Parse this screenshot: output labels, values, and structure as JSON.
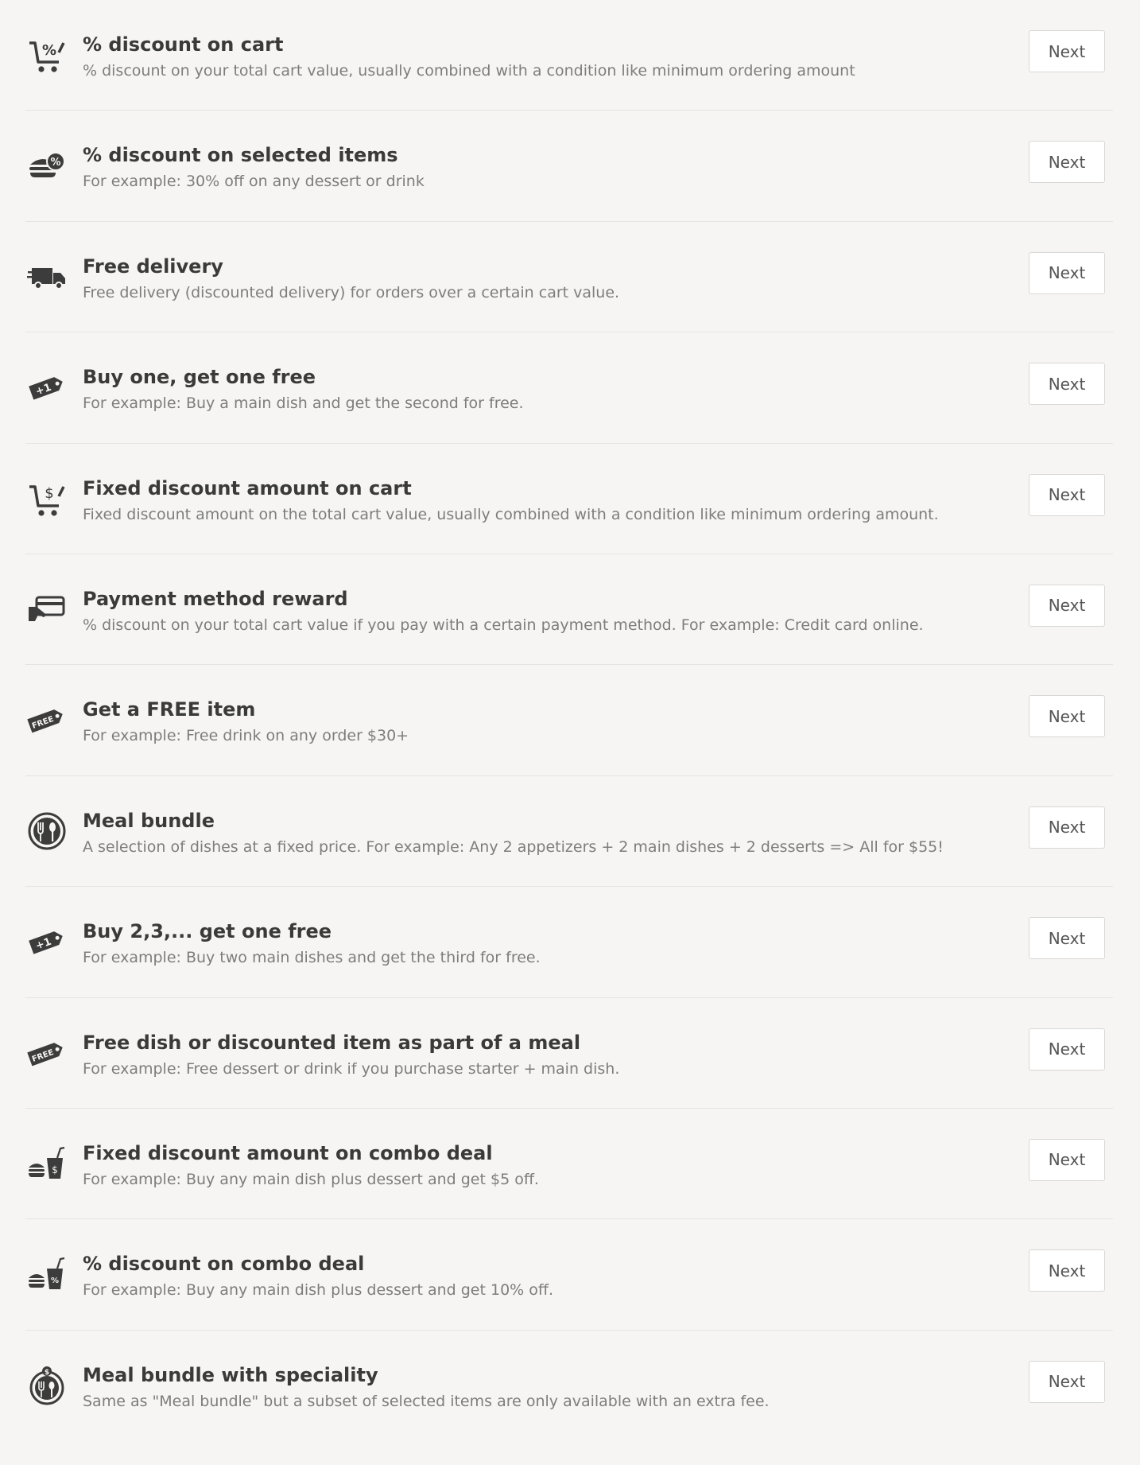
{
  "button_label": "Next",
  "icon_color": "#3c3c3c",
  "items": [
    {
      "icon": "percent-cart-icon",
      "title": "% discount on cart",
      "description": "% discount on your total cart value, usually combined with a condition like minimum ordering amount"
    },
    {
      "icon": "burger-percent-icon",
      "title": "% discount on selected items",
      "description": "For example: 30% off on any dessert or drink"
    },
    {
      "icon": "delivery-truck-icon",
      "title": "Free delivery",
      "description": "Free delivery (discounted delivery) for orders over a certain cart value."
    },
    {
      "icon": "plus-one-tag-icon",
      "title": "Buy one, get one free",
      "description": "For example: Buy a main dish and get the second for free."
    },
    {
      "icon": "dollar-cart-icon",
      "title": "Fixed discount amount on cart",
      "description": "Fixed discount amount on the total cart value, usually combined with a condition like minimum ordering amount."
    },
    {
      "icon": "card-hand-icon",
      "title": "Payment method reward",
      "description": "% discount on your total cart value if you pay with a certain payment method. For example: Credit card online."
    },
    {
      "icon": "free-tag-icon",
      "title": "Get a FREE item",
      "description": "For example: Free drink on any order $30+"
    },
    {
      "icon": "cutlery-plate-icon",
      "title": "Meal bundle",
      "description": "A selection of dishes at a fixed price. For example: Any 2 appetizers + 2 main dishes + 2 desserts => All for $55!"
    },
    {
      "icon": "plus-one-tag-icon",
      "title": "Buy 2,3,... get one free",
      "description": "For example: Buy two main dishes and get the third for free."
    },
    {
      "icon": "free-tag-icon",
      "title": "Free dish or discounted item as part of a meal",
      "description": "For example: Free dessert or drink if you purchase starter + main dish."
    },
    {
      "icon": "combo-dollar-icon",
      "title": "Fixed discount amount on combo deal",
      "description": "For example: Buy any main dish plus dessert and get $5 off."
    },
    {
      "icon": "combo-percent-icon",
      "title": "% discount on combo deal",
      "description": "For example: Buy any main dish plus dessert and get 10% off."
    },
    {
      "icon": "plate-dollar-icon",
      "title": "Meal bundle with speciality",
      "description": "Same as \"Meal bundle\" but a subset of selected items are only available with an extra fee."
    }
  ]
}
